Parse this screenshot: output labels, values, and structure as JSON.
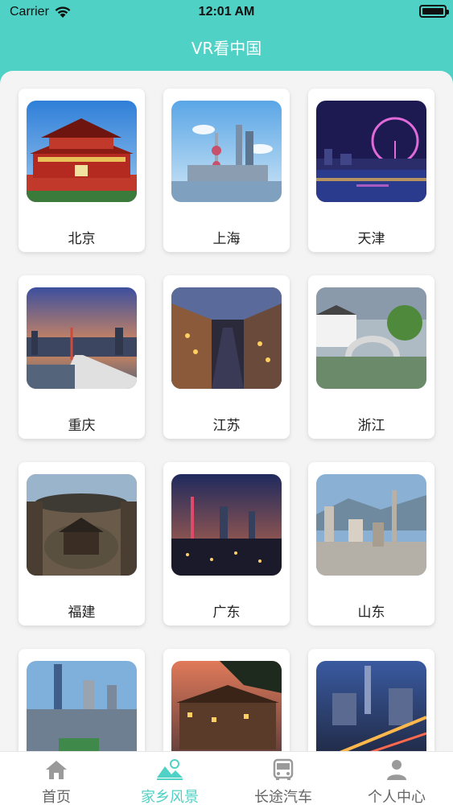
{
  "status_bar": {
    "carrier": "Carrier",
    "time": "12:01 AM"
  },
  "nav": {
    "title": "VR看中国"
  },
  "regions": [
    {
      "name": "北京",
      "scene": "tiananmen"
    },
    {
      "name": "上海",
      "scene": "shanghai-skyline"
    },
    {
      "name": "天津",
      "scene": "tianjin-eye"
    },
    {
      "name": "重庆",
      "scene": "chongqing-bridge"
    },
    {
      "name": "江苏",
      "scene": "water-town"
    },
    {
      "name": "浙江",
      "scene": "stone-bridge"
    },
    {
      "name": "福建",
      "scene": "tulou"
    },
    {
      "name": "广东",
      "scene": "guangzhou-night"
    },
    {
      "name": "山东",
      "scene": "city-mountains"
    },
    {
      "name": "",
      "scene": "city-towers"
    },
    {
      "name": "",
      "scene": "fenghuang"
    },
    {
      "name": "",
      "scene": "city-night"
    }
  ],
  "tabbar": {
    "tabs": [
      {
        "label": "首页",
        "icon": "home-icon",
        "active": false
      },
      {
        "label": "家乡风景",
        "icon": "landscape-icon",
        "active": true
      },
      {
        "label": "长途汽车",
        "icon": "bus-icon",
        "active": false
      },
      {
        "label": "个人中心",
        "icon": "person-icon",
        "active": false
      }
    ]
  },
  "colors": {
    "accent": "#4fd1c5",
    "background": "#f4f4f4",
    "tab_inactive": "#666666"
  }
}
